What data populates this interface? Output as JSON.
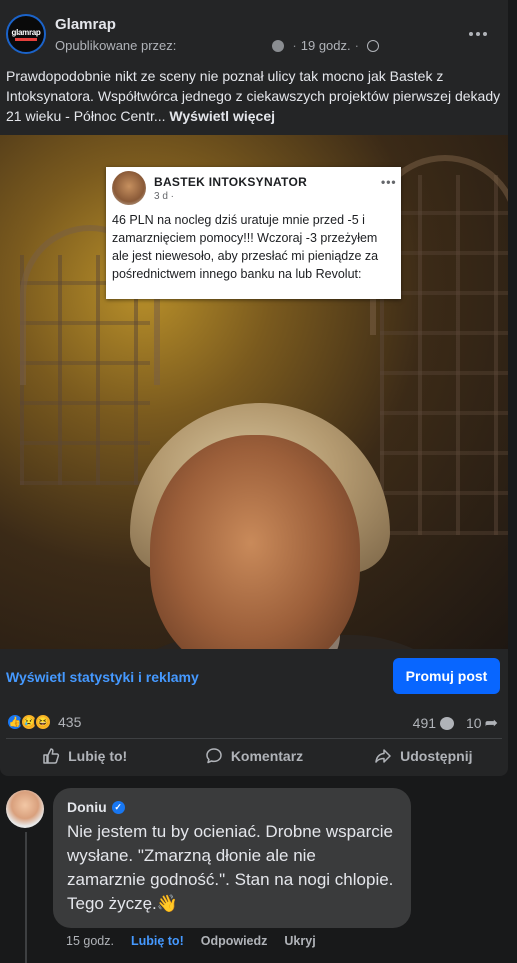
{
  "post": {
    "page_name": "Glamrap",
    "avatar_logo_text": "glamrap",
    "published_by": "Opublikowane przez:",
    "time": "19 godz.",
    "caption": "Prawdopodobnie nikt ze sceny nie poznał ulicy tak mocno jak Bastek z Intoksynatora. Współtwórca jednego z ciekawszych projektów pierwszej dekady 21 wieku - Północ Centr...",
    "see_more": "Wyświetl więcej"
  },
  "embedded": {
    "name": "BASTEK INTOKSYNATOR",
    "meta": "3 d ·",
    "dots": "•••",
    "text": "46 PLN na nocleg dziś uratuje mnie przed -5 i zamarznięciem pomocy!!! Wczoraj -3 przeżyłem ale jest niewesoło, aby przesłać mi pieniądze za pośrednictwem innego banku na lub Revolut:"
  },
  "promo": {
    "stats_link": "Wyświetl statystyki i reklamy",
    "promote_button": "Promuj post"
  },
  "engagement": {
    "reactions_count": "435",
    "comments_count": "491",
    "shares_count": "10"
  },
  "actions": {
    "like": "Lubię to!",
    "comment": "Komentarz",
    "share": "Udostępnij"
  },
  "comment": {
    "author": "Doniu",
    "text": "Nie jestem tu by ocieniać. Drobne wsparcie wysłane. \"Zmarzną dłonie ale nie zamarznie godność.\". Stan na nogi chlopie. Tego życzę.👋",
    "time": "15 godz.",
    "like": "Lubię to!",
    "reply": "Odpowiedz",
    "hide": "Ukryj"
  },
  "colors": {
    "background": "#18191a",
    "card": "#242526",
    "accent": "#0866ff",
    "link": "#4599ff"
  }
}
